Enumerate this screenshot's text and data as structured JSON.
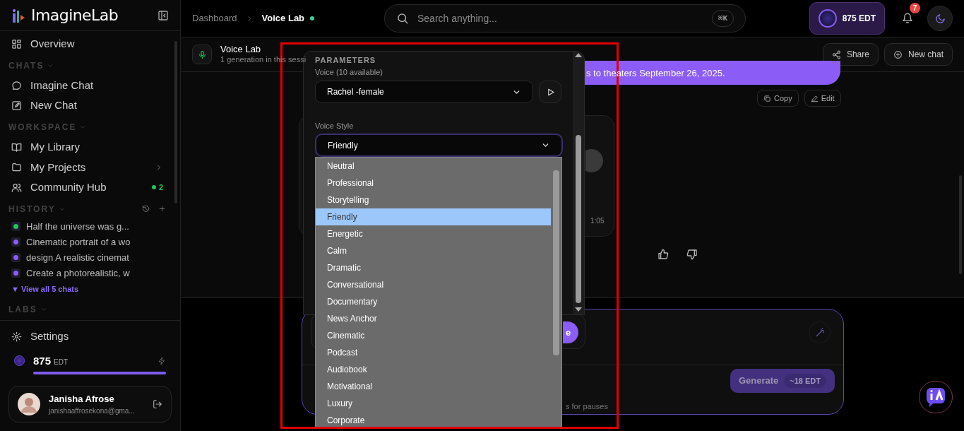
{
  "sidebar": {
    "brand": "ImagineLab",
    "items": [
      {
        "kind": "link",
        "label": "Overview"
      },
      {
        "kind": "section",
        "label": "CHATS"
      },
      {
        "kind": "link",
        "label": "Imagine Chat"
      },
      {
        "kind": "link",
        "label": "New Chat"
      },
      {
        "kind": "section",
        "label": "WORKSPACE"
      },
      {
        "kind": "link",
        "label": "My Library"
      },
      {
        "kind": "folder",
        "label": "My Projects"
      },
      {
        "kind": "badge",
        "label": "Community Hub",
        "badge": "2"
      },
      {
        "kind": "history_header",
        "label": "HISTORY"
      },
      {
        "kind": "history",
        "label": "Half the universe was g...",
        "color": "#22c55e"
      },
      {
        "kind": "history",
        "label": "Cinematic portrait of a wo",
        "color": "#8b5cf6"
      },
      {
        "kind": "history",
        "label": "design A realistic cinemat",
        "color": "#8b5cf6"
      },
      {
        "kind": "history",
        "label": "Create a photorealistic, w",
        "color": "#8b5cf6"
      },
      {
        "kind": "more",
        "label": "▼ View all 5 chats"
      },
      {
        "kind": "section",
        "label": "LABS"
      }
    ],
    "settings": "Settings",
    "credits": {
      "amount": "875",
      "unit": "EDT",
      "level": 1
    },
    "user": {
      "name": "Janisha Afrose",
      "email": "janishaaffrosekona@gma..."
    }
  },
  "header": {
    "breadcrumb": [
      "Dashboard",
      "Voice Lab"
    ],
    "search": {
      "placeholder": "Search anything...",
      "shortcut": "⌘K"
    },
    "credits": "875 EDT",
    "notifications": "7"
  },
  "subheader": {
    "title": "Voice Lab",
    "subtitle": "1 generation in this sessi",
    "buttons": [
      "Share",
      "New chat"
    ]
  },
  "chat": {
    "message_tail": "s to theaters September 26, 2025.",
    "message_actions": [
      "Copy",
      "Edit"
    ],
    "duration": "1:05",
    "hint_tail": "s for pauses",
    "button_tail": "e",
    "generate": {
      "label": "Generate",
      "cost": "~18 EDT"
    }
  },
  "parameters": {
    "title": "PARAMETERS",
    "voice_label": "Voice (10 available)",
    "voice": "Rachel -female",
    "style_label": "Voice Style",
    "style": "Friendly",
    "style_options": [
      {
        "label": "Neutral",
        "selected": false
      },
      {
        "label": "Professional",
        "selected": false
      },
      {
        "label": "Storytelling",
        "selected": false
      },
      {
        "label": "Friendly",
        "selected": true
      },
      {
        "label": "Energetic",
        "selected": false
      },
      {
        "label": "Calm",
        "selected": false
      },
      {
        "label": "Dramatic",
        "selected": false
      },
      {
        "label": "Conversational",
        "selected": false
      },
      {
        "label": "Documentary",
        "selected": false
      },
      {
        "label": "News Anchor",
        "selected": false
      },
      {
        "label": "Cinematic",
        "selected": false
      },
      {
        "label": "Podcast",
        "selected": false
      },
      {
        "label": "Audiobook",
        "selected": false
      },
      {
        "label": "Motivational",
        "selected": false
      },
      {
        "label": "Luxury",
        "selected": false
      },
      {
        "label": "Corporate",
        "selected": false
      }
    ]
  }
}
